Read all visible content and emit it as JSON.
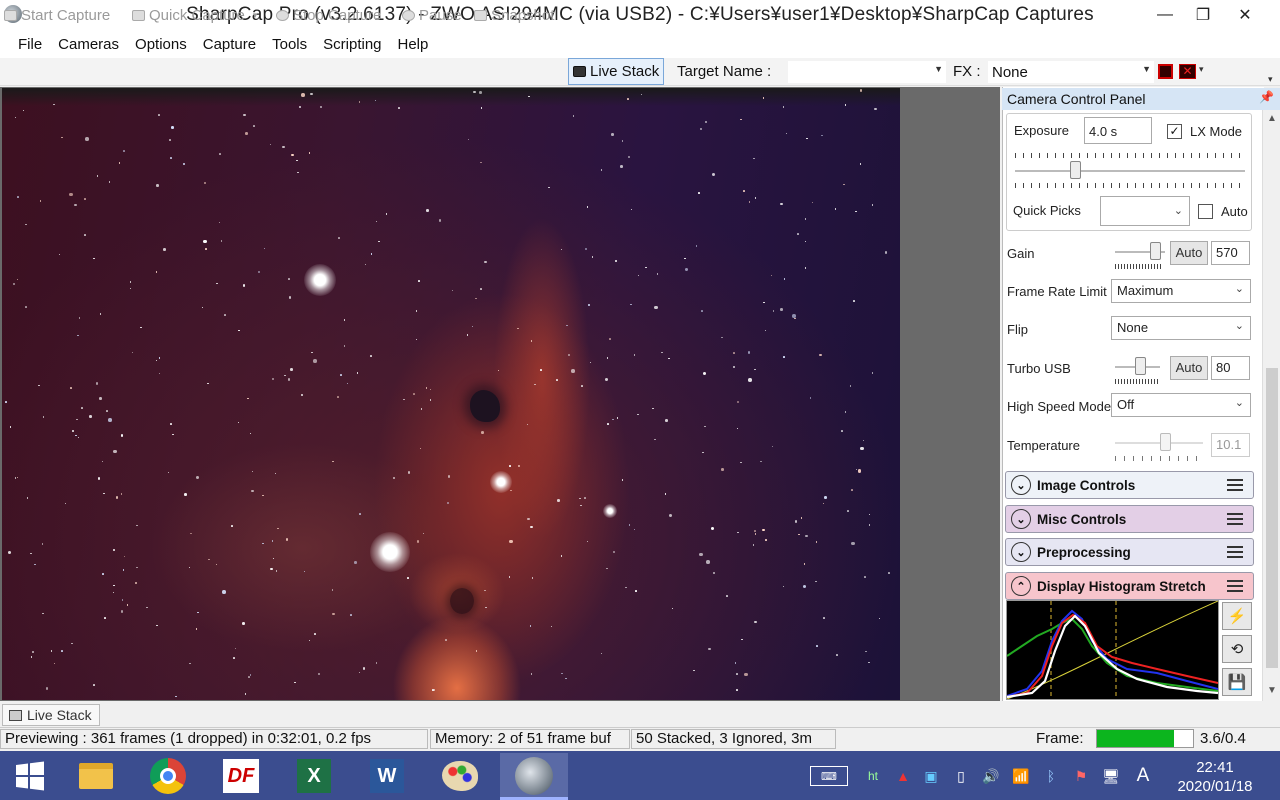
{
  "window": {
    "title": "SharpCap Pro (v3.2.6137) - ZWO ASI294MC (via USB2) - C:¥Users¥user1¥Desktop¥SharpCap Captures",
    "minimize": "—",
    "maximize": "❐",
    "close": "✕"
  },
  "menu": [
    "File",
    "Cameras",
    "Options",
    "Capture",
    "Tools",
    "Scripting",
    "Help"
  ],
  "toolbar": {
    "start_capture": "Start Capture",
    "quick_capture": "Quick Capture",
    "stop_capture": "Stop Capture",
    "pause": "Pause",
    "snapshot": "Snapshot",
    "live_stack": "Live Stack",
    "target_name_label": "Target Name :",
    "target_name_value": "",
    "fx_label": "FX :",
    "fx_value": "None"
  },
  "panel": {
    "title": "Camera Control Panel",
    "exposure_label": "Exposure",
    "exposure_value": "4.0 s",
    "lx_mode_label": "LX Mode",
    "lx_mode_checked": "✓",
    "exposure_slider": 0.25,
    "quick_picks_label": "Quick Picks",
    "quick_picks_value": "",
    "auto_label": "Auto",
    "gain_label": "Gain",
    "gain_auto": "Auto",
    "gain_value": "570",
    "gain_slider": 0.9,
    "frame_rate_label": "Frame Rate Limit",
    "frame_rate_value": "Maximum",
    "flip_label": "Flip",
    "flip_value": "None",
    "turbo_usb_label": "Turbo USB",
    "turbo_usb_auto": "Auto",
    "turbo_usb_value": "80",
    "turbo_slider": 0.6,
    "high_speed_label": "High Speed Mode",
    "high_speed_value": "Off",
    "temperature_label": "Temperature",
    "temperature_value": "10.1",
    "temperature_slider": 0.58,
    "sections": [
      {
        "label": "Image Controls",
        "color": "#eef2f8"
      },
      {
        "label": "Misc Controls",
        "color": "#e3cfe6"
      },
      {
        "label": "Preprocessing",
        "color": "#e6e6f3"
      },
      {
        "label": "Display Histogram Stretch",
        "color": "#f7c5cc"
      }
    ]
  },
  "bottom_tab": "Live Stack",
  "status": {
    "previewing": "Previewing : 361 frames (1 dropped) in 0:32:01, 0.2 fps",
    "memory": "Memory: 2 of 51 frame buf",
    "stacked": "50 Stacked, 3 Ignored, 3m",
    "frame_label": "Frame:",
    "frame_fill": 0.8,
    "frame_value": "3.6/0.4"
  },
  "taskbar": {
    "apps": [
      "windows-start",
      "file-explorer",
      "chrome",
      "df-app",
      "excel",
      "word",
      "paint",
      "sharpcap"
    ],
    "ime": "A",
    "clock_time": "22:41",
    "clock_date": "2020/01/18"
  }
}
